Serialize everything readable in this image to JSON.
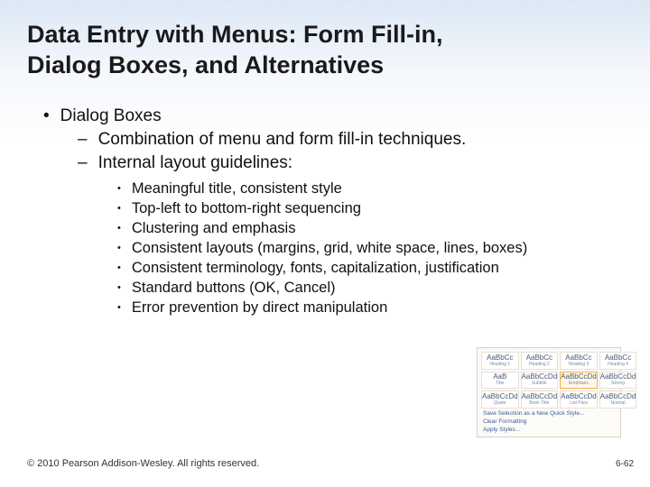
{
  "title_line1": "Data Entry with Menus: Form Fill-in,",
  "title_line2": "Dialog Boxes, and Alternatives",
  "l1_a": "Dialog Boxes",
  "l2_a": "Combination of menu and form fill-in techniques.",
  "l2_b": "Internal layout guidelines:",
  "l3": [
    "Meaningful title, consistent style",
    "Top-left to bottom-right sequencing",
    "Clustering and emphasis",
    "Consistent layouts (margins, grid, white space, lines, boxes)",
    "Consistent terminology, fonts, capitalization, justification",
    "Standard buttons (OK, Cancel)",
    "Error prevention by direct manipulation"
  ],
  "footer": "© 2010 Pearson Addison-Wesley. All rights reserved.",
  "pagenum": "6-62",
  "thumb": {
    "cells": [
      {
        "t1": "AaBbCc",
        "t2": "Heading 1"
      },
      {
        "t1": "AaBbCc",
        "t2": "Heading 2"
      },
      {
        "t1": "AaBbCc",
        "t2": "Heading 3"
      },
      {
        "t1": "AaBbCc",
        "t2": "Heading 4"
      },
      {
        "t1": "AaB",
        "t2": "Title"
      },
      {
        "t1": "AaBbCcDd",
        "t2": "Subtitle"
      },
      {
        "t1": "AaBbCcDd",
        "t2": "Emphasis",
        "sel": true
      },
      {
        "t1": "AaBbCcDd",
        "t2": "Strong"
      },
      {
        "t1": "AaBbCcDd",
        "t2": "Quote"
      },
      {
        "t1": "AaBbCcDd",
        "t2": "Book Title"
      },
      {
        "t1": "AaBbCcDd",
        "t2": "List Para"
      },
      {
        "t1": "AaBbCcDd",
        "t2": "Normal"
      }
    ],
    "link1": "Save Selection as a New Quick Style...",
    "link2": "Clear Formatting",
    "link3": "Apply Styles..."
  }
}
